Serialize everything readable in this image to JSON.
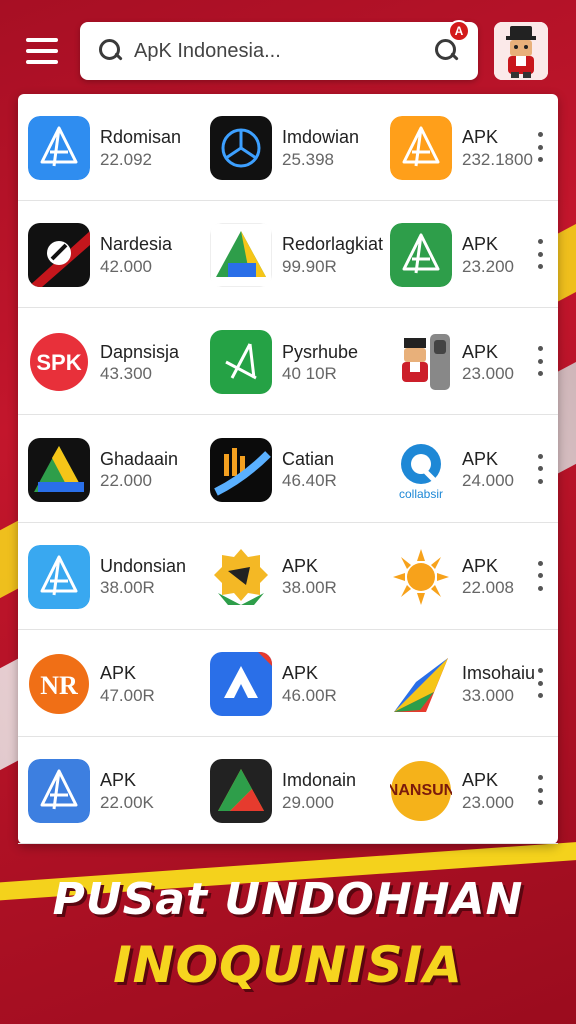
{
  "header": {
    "search_placeholder": "ApK Indonesia...",
    "notification_badge": "A"
  },
  "apps": [
    {
      "name": "Rdomisan",
      "value": "22.092",
      "icon": "apk-store-blue-icon",
      "color": "#2f8df0"
    },
    {
      "name": "Imdowian",
      "value": "25.398",
      "icon": "dark-circle-logo-icon",
      "color": "#111111"
    },
    {
      "name": "APK",
      "value": "232.1800",
      "icon": "apk-store-orange-icon",
      "color": "#ff9f1a"
    },
    {
      "name": "Nardesia",
      "value": "42.000",
      "icon": "red-black-logo-icon",
      "color": "#c4161c"
    },
    {
      "name": "Redorlagkiat",
      "value": "99.90R",
      "icon": "triangle-drive-icon",
      "color": "#f5c518"
    },
    {
      "name": "APK",
      "value": "23.200",
      "icon": "apk-store-green-icon",
      "color": "#2e9e4a"
    },
    {
      "name": "Dapnsisja",
      "value": "43.300",
      "icon": "spk-red-icon",
      "color": "#e8303a"
    },
    {
      "name": "Pysrhube",
      "value": "40 10R",
      "icon": "green-triangle-icon",
      "color": "#25a245"
    },
    {
      "name": "APK",
      "value": "23.000",
      "icon": "mascot-phone-icon",
      "color": "#cc1f2a"
    },
    {
      "name": "Ghadaain",
      "value": "22.000",
      "icon": "drive-triangle-dark-icon",
      "color": "#1a1a1a"
    },
    {
      "name": "Catian",
      "value": "46.40R",
      "icon": "chart-swoosh-icon",
      "color": "#0b0b0b"
    },
    {
      "name": "APK",
      "value": "24.000",
      "icon": "collabsir-logo-icon",
      "color": "#1e88d6"
    },
    {
      "name": "Undonsian",
      "value": "38.00R",
      "icon": "apk-store-lightblue-icon",
      "color": "#39a8f0"
    },
    {
      "name": "APK",
      "value": "38.00R",
      "icon": "gear-badge-icon",
      "color": "#f4b825"
    },
    {
      "name": "APK",
      "value": "22.008",
      "icon": "sun-icon",
      "color": "#f7a21b"
    },
    {
      "name": "APK",
      "value": "47.00R",
      "icon": "nr-logo-icon",
      "color": "#f06f16"
    },
    {
      "name": "APK",
      "value": "46.00R",
      "icon": "blue-a-logo-icon",
      "color": "#2a6fe8"
    },
    {
      "name": "Imsohaiu",
      "value": "33.000",
      "icon": "colorful-paper-plane-icon",
      "color": "#e63b2e"
    },
    {
      "name": "APK",
      "value": "22.00K",
      "icon": "apk-store-blue-icon",
      "color": "#3d7fe0"
    },
    {
      "name": "Imdonain",
      "value": "29.000",
      "icon": "drive-triangle-icon",
      "color": "#222222"
    },
    {
      "name": "APK",
      "value": "23.000",
      "icon": "nansun-logo-icon",
      "color": "#f5b21a"
    }
  ],
  "footer": {
    "line1": "PUSat UNDOHHAN",
    "line2": "INOQUNISIA"
  }
}
